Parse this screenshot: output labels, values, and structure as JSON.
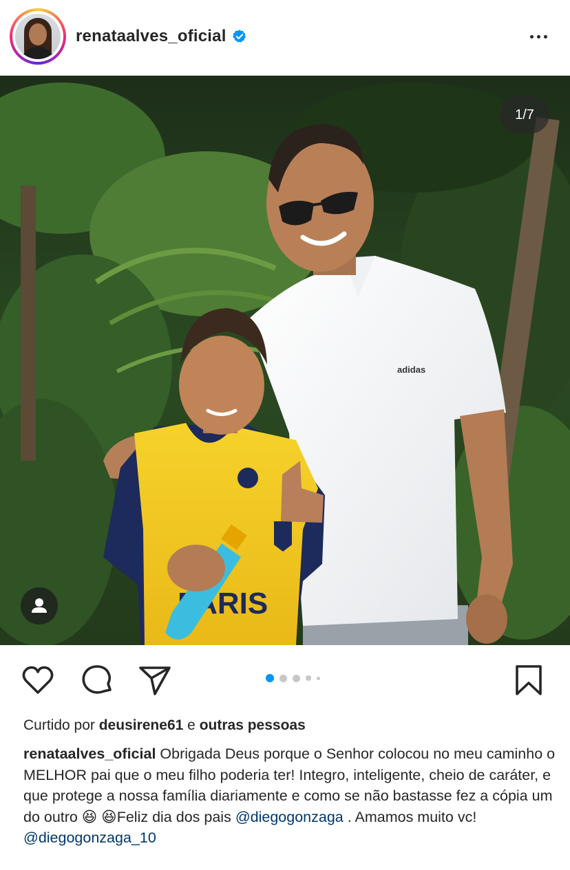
{
  "header": {
    "username": "renataalves_oficial",
    "verified": true,
    "avatar": "profile-photo",
    "more_icon": "more-horizontal-icon"
  },
  "post": {
    "photo_counter": "1/7",
    "tag_icon": "user-tag-icon",
    "carousel": {
      "total_dots": 5,
      "active_index": 0
    }
  },
  "actions": {
    "like_icon": "heart-icon",
    "comment_icon": "comment-icon",
    "share_icon": "send-icon",
    "save_icon": "bookmark-icon"
  },
  "likes": {
    "prefix": "Curtido por",
    "user": "deusirene61",
    "connector": "e",
    "others": "outras pessoas"
  },
  "caption": {
    "username": "renataalves_oficial",
    "text_1": "Obrigada Deus porque o Senhor colocou no meu caminho o MELHOR pai que o meu filho poderia ter! Integro, inteligente, cheio de caráter, e que protege a nossa família diariamente e como se não bastasse fez a cópia um do outro",
    "emoji": "😆 😆",
    "text_2": "Feliz dia dos pais",
    "mention_1": "@diegogonzaga",
    "text_3": ". Amamos muito vc!",
    "mention_2": "@diegogonzaga_10"
  },
  "colors": {
    "text": "#262626",
    "mention": "#00376b",
    "active_dot": "#0095f6",
    "verified": "#0095f6"
  }
}
